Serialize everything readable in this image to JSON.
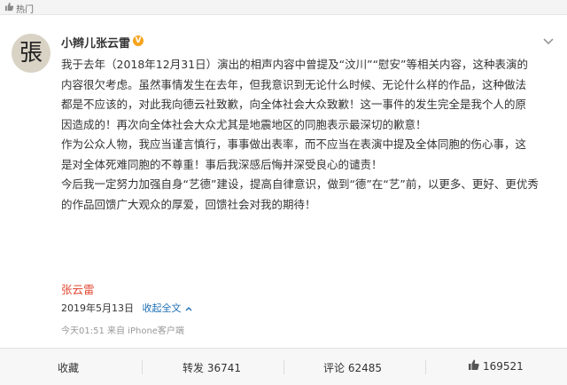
{
  "topbar": {
    "label": "热门",
    "icon": "thumbs-up-icon"
  },
  "post": {
    "author": {
      "name": "小辫儿张云雷",
      "avatar_text": "張",
      "verified": "V"
    },
    "paragraphs": [
      "我于去年（2018年12月31日）演出的相声内容中曾提及“汶川”“慰安”等相关内容，这种表演的\n内容很欠考虑。虽然事情发生在去年，但我意识到无论什么时候、无论什么样的作品，这种做法\n都是不应该的，对此我向德云社致歉，向全体社会大众致歉！这一事件的发生完全是我个人的原\n因造成的！再次向全体社会大众尤其是地震地区的同胞表示最深切的歉意！",
      "作为公众人物，我应当谨言慎行，事事做出表率，而不应当在表演中提及全体同胞的伤心事，这\n是对全体死难同胞的不尊重！事后我深感后悔并深受良心的谴责！",
      "今后我一定努力加强自身“艺德”建设，提高自律意识，做到“德”在“艺”前，以更多、更好、更优秀\n的作品回馈广大观众的厚爱，回馈社会对我的期待！"
    ],
    "signature": "张云雷",
    "date": "2019年5月13日",
    "collapse_link": "收起全文",
    "meta": "今天01:51 来自 iPhone客户端"
  },
  "actions": {
    "favorite": "收藏",
    "repost": "转发 36741",
    "comment": "评论 62485",
    "like": "169521"
  },
  "colors": {
    "link": "#1f6fb4",
    "signature": "#e0442e",
    "badge": "#f7a41e"
  }
}
